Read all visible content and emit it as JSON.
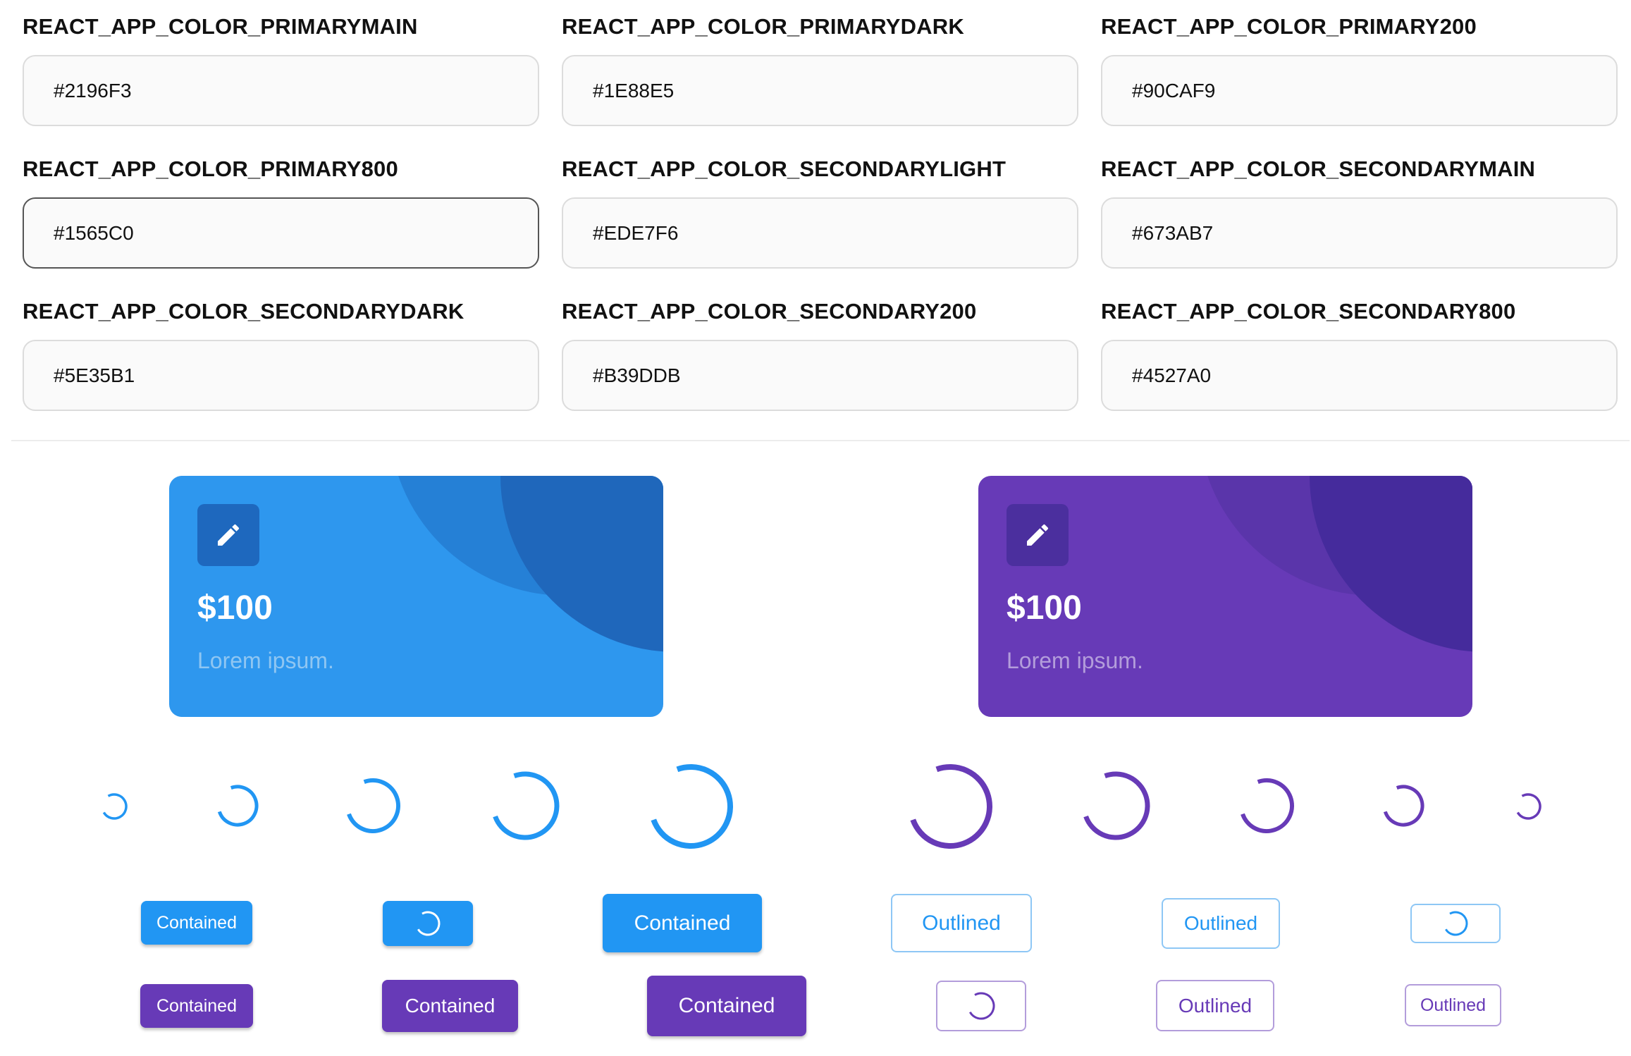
{
  "colors": {
    "primary": "#2196F3",
    "primary_card": "#2E97EE",
    "primary_circle1": "#2580D6",
    "primary_circle2": "#1F67BB",
    "primary_icon_bg": "#1E68BE",
    "primary_sub": "#8FC6F2",
    "secondary": "#673AB7",
    "secondary_circle1": "#5A35AA",
    "secondary_circle2": "#452B9C",
    "secondary_icon_bg": "#4B2F9E",
    "secondary_sub": "#B39DDB"
  },
  "fields": [
    {
      "label": "REACT_APP_COLOR_PRIMARYMAIN",
      "value": "#2196F3"
    },
    {
      "label": "REACT_APP_COLOR_PRIMARYDARK",
      "value": "#1E88E5"
    },
    {
      "label": "REACT_APP_COLOR_PRIMARY200",
      "value": "#90CAF9"
    },
    {
      "label": "REACT_APP_COLOR_PRIMARY800",
      "value": "#1565C0",
      "focused": true
    },
    {
      "label": "REACT_APP_COLOR_SECONDARYLIGHT",
      "value": "#EDE7F6"
    },
    {
      "label": "REACT_APP_COLOR_SECONDARYMAIN",
      "value": "#673AB7"
    },
    {
      "label": "REACT_APP_COLOR_SECONDARYDARK",
      "value": "#5E35B1"
    },
    {
      "label": "REACT_APP_COLOR_SECONDARY200",
      "value": "#B39DDB"
    },
    {
      "label": "REACT_APP_COLOR_SECONDARY800",
      "value": "#4527A0"
    }
  ],
  "cards": [
    {
      "amount": "$100",
      "subtitle": "Lorem ipsum.",
      "icon": "pencil-icon"
    },
    {
      "amount": "$100",
      "subtitle": "Lorem ipsum.",
      "icon": "pencil-icon"
    }
  ],
  "buttons": {
    "contained": "Contained",
    "outlined": "Outlined"
  }
}
